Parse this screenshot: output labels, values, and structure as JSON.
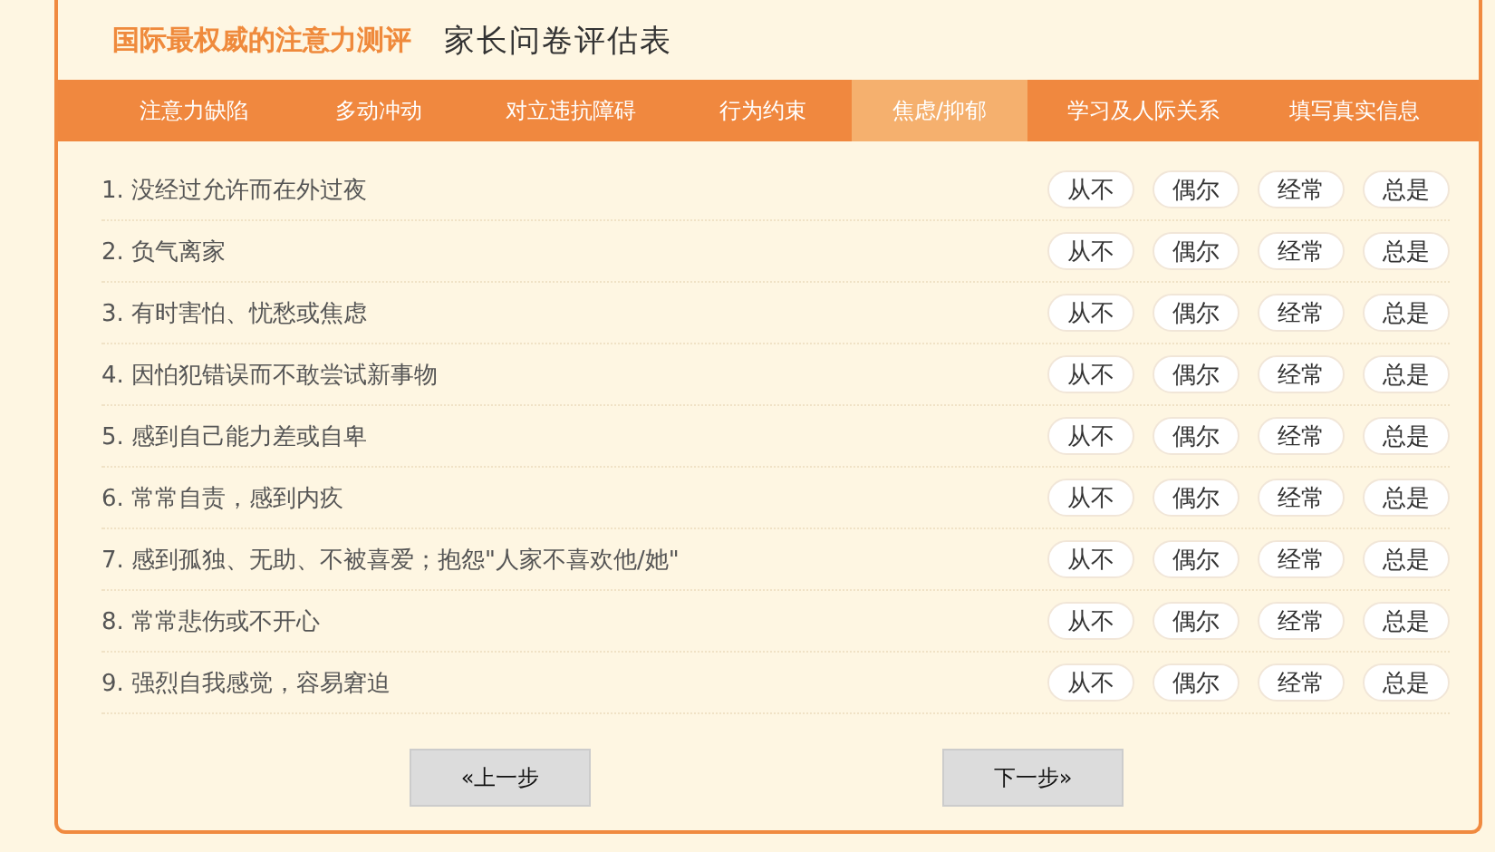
{
  "header": {
    "brand": "国际最权威的注意力测评",
    "title": "家长问卷评估表"
  },
  "tabs": [
    {
      "label": "注意力缺陷",
      "selected": false
    },
    {
      "label": "多动冲动",
      "selected": false
    },
    {
      "label": "对立违抗障碍",
      "selected": false
    },
    {
      "label": "行为约束",
      "selected": false
    },
    {
      "label": "焦虑/抑郁",
      "selected": true
    },
    {
      "label": "学习及人际关系",
      "selected": false
    },
    {
      "label": "填写真实信息",
      "selected": false
    }
  ],
  "questions": [
    {
      "text": "1. 没经过允许而在外过夜",
      "options": [
        {
          "label": "从不",
          "selected": false
        },
        {
          "label": "偶尔",
          "selected": false
        },
        {
          "label": "经常",
          "selected": false
        },
        {
          "label": "总是",
          "selected": false
        }
      ]
    },
    {
      "text": "2. 负气离家",
      "options": [
        {
          "label": "从不",
          "selected": false
        },
        {
          "label": "偶尔",
          "selected": false
        },
        {
          "label": "经常",
          "selected": false
        },
        {
          "label": "总是",
          "selected": false
        }
      ]
    },
    {
      "text": "3. 有时害怕、忧愁或焦虑",
      "options": [
        {
          "label": "从不",
          "selected": false
        },
        {
          "label": "偶尔",
          "selected": false
        },
        {
          "label": "经常",
          "selected": false
        },
        {
          "label": "总是",
          "selected": false
        }
      ]
    },
    {
      "text": "4. 因怕犯错误而不敢尝试新事物",
      "options": [
        {
          "label": "从不",
          "selected": false
        },
        {
          "label": "偶尔",
          "selected": false
        },
        {
          "label": "经常",
          "selected": false
        },
        {
          "label": "总是",
          "selected": false
        }
      ]
    },
    {
      "text": "5. 感到自己能力差或自卑",
      "options": [
        {
          "label": "从不",
          "selected": false
        },
        {
          "label": "偶尔",
          "selected": false
        },
        {
          "label": "经常",
          "selected": false
        },
        {
          "label": "总是",
          "selected": false
        }
      ]
    },
    {
      "text": "6. 常常自责，感到内疚",
      "options": [
        {
          "label": "从不",
          "selected": false
        },
        {
          "label": "偶尔",
          "selected": false
        },
        {
          "label": "经常",
          "selected": false
        },
        {
          "label": "总是",
          "selected": false
        }
      ]
    },
    {
      "text": "7. 感到孤独、无助、不被喜爱；抱怨\"人家不喜欢他/她\"",
      "options": [
        {
          "label": "从不",
          "selected": false
        },
        {
          "label": "偶尔",
          "selected": false
        },
        {
          "label": "经常",
          "selected": false
        },
        {
          "label": "总是",
          "selected": false
        }
      ]
    },
    {
      "text": "8. 常常悲伤或不开心",
      "options": [
        {
          "label": "从不",
          "selected": false
        },
        {
          "label": "偶尔",
          "selected": false
        },
        {
          "label": "经常",
          "selected": false
        },
        {
          "label": "总是",
          "selected": false
        }
      ]
    },
    {
      "text": "9. 强烈自我感觉，容易窘迫",
      "options": [
        {
          "label": "从不",
          "selected": false
        },
        {
          "label": "偶尔",
          "selected": false
        },
        {
          "label": "经常",
          "selected": false
        },
        {
          "label": "总是",
          "selected": false
        }
      ]
    }
  ],
  "buttons": [
    {
      "label": "«上一步"
    },
    {
      "label": "下一步»"
    }
  ]
}
